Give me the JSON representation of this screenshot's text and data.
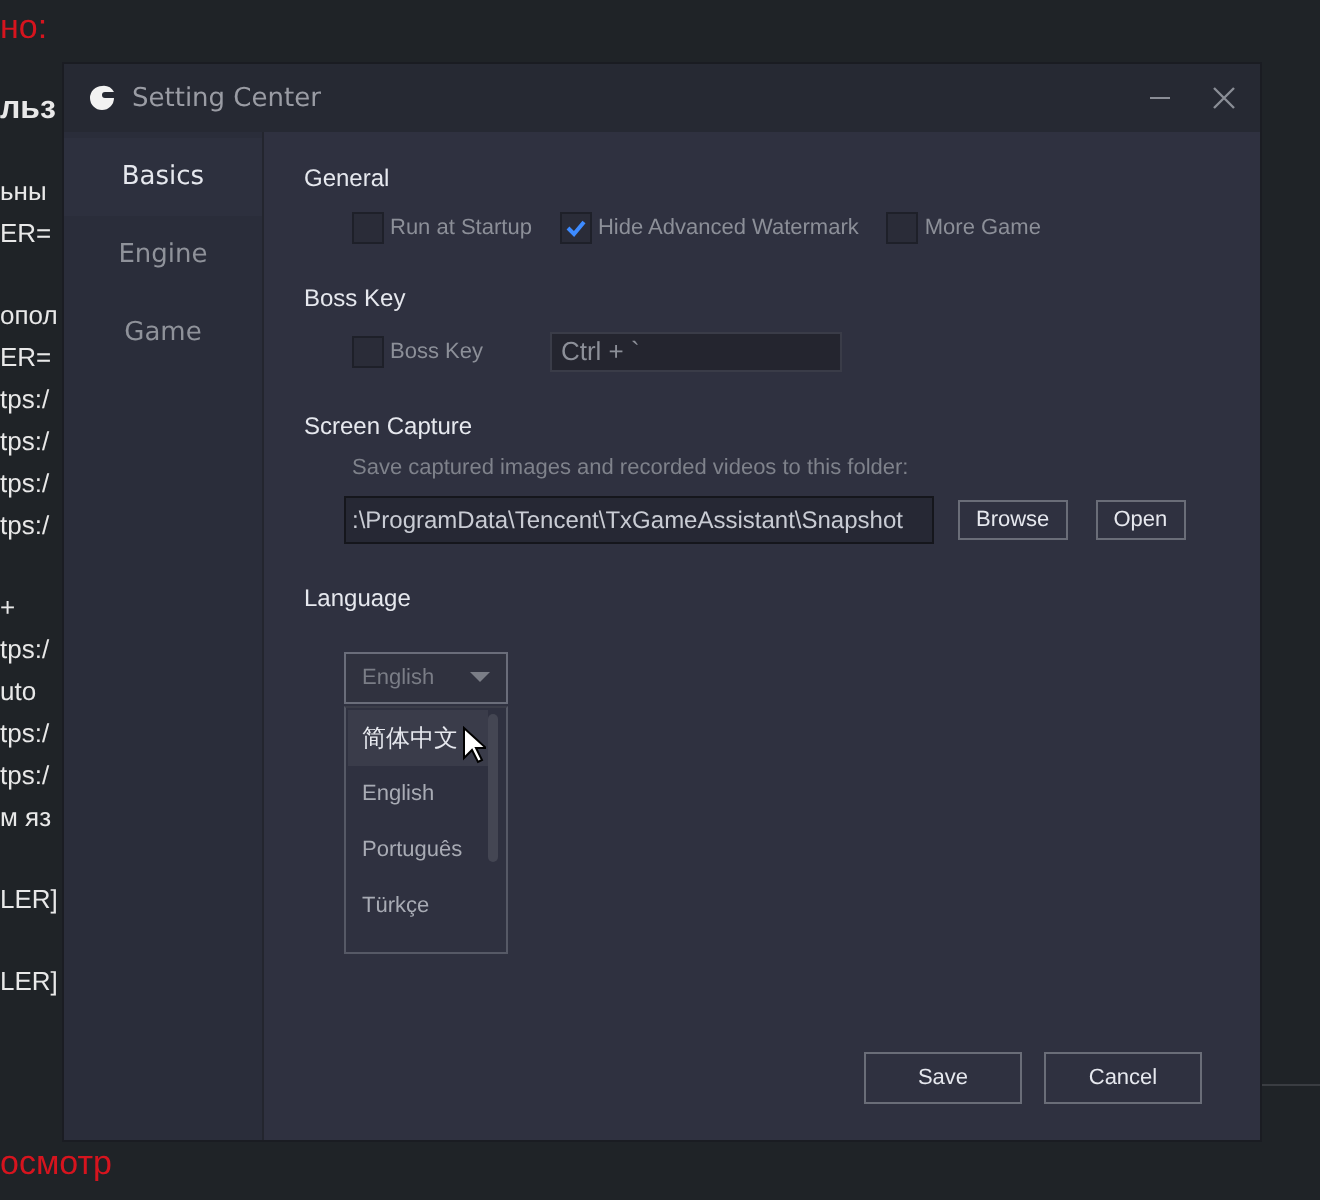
{
  "background_page": {
    "paragraphs": [
      {
        "kind": "heading",
        "lines": [
          "но:"
        ]
      },
      {
        "kind": "title",
        "lines": [
          "льз"
        ]
      },
      {
        "kind": "text",
        "lines": [
          "ьны",
          "ER="
        ]
      },
      {
        "kind": "text",
        "lines": [
          "опол",
          "ER=",
          "tps:/",
          "tps:/",
          "tps:/",
          "tps:/"
        ]
      },
      {
        "kind": "text",
        "lines": [
          "+",
          "tps:/",
          "uto",
          "tps:/",
          "tps:/",
          "м яз"
        ]
      },
      {
        "kind": "text",
        "lines": [
          "LER]"
        ]
      },
      {
        "kind": "text",
        "lines": [
          "LER]"
        ]
      },
      {
        "kind": "heading",
        "lines": [
          "осмотр"
        ]
      }
    ]
  },
  "window": {
    "title": "Setting Center"
  },
  "sidebar": {
    "items": [
      {
        "label": "Basics",
        "selected": true
      },
      {
        "label": "Engine",
        "selected": false
      },
      {
        "label": "Game",
        "selected": false
      }
    ]
  },
  "sections": [
    {
      "kind": "checkboxes",
      "title": "General",
      "options": [
        {
          "label": "Run at Startup",
          "checked": false
        },
        {
          "label": "Hide Advanced Watermark",
          "checked": true
        },
        {
          "label": "More Game",
          "checked": false
        }
      ]
    },
    {
      "kind": "hotkey",
      "title": "Boss Key",
      "option": {
        "label": "Boss Key",
        "checked": false
      },
      "value": "Ctrl + `"
    },
    {
      "kind": "folder",
      "title": "Screen Capture",
      "hint": "Save captured images and recorded videos to this folder:",
      "value": ":\\ProgramData\\Tencent\\TxGameAssistant\\Snapshot",
      "buttons": [
        "Browse",
        "Open"
      ]
    },
    {
      "kind": "dropdown",
      "title": "Language",
      "value": "English",
      "expanded": true,
      "options": [
        {
          "label": "简体中文",
          "highlighted": true
        },
        {
          "label": "English",
          "highlighted": false
        },
        {
          "label": "Português",
          "highlighted": false
        },
        {
          "label": "Türkçe",
          "highlighted": false
        }
      ]
    }
  ],
  "buttons": [
    "Save",
    "Cancel"
  ]
}
